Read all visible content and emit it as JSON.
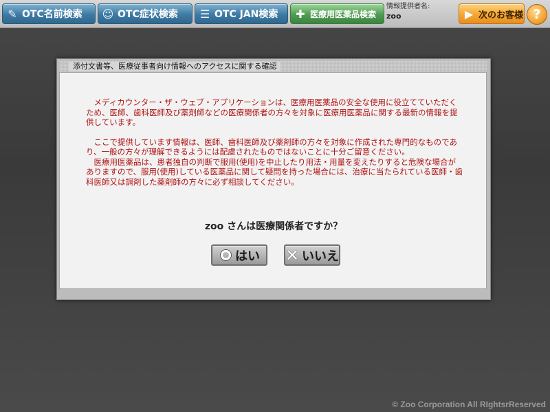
{
  "toolbar": {
    "buttons": [
      {
        "label": "OTC名前検索",
        "icon": "pill-icon"
      },
      {
        "label": "OTC症状検索",
        "icon": "body-icon"
      },
      {
        "label": "OTC JAN検索",
        "icon": "barcode-icon"
      },
      {
        "label": "医療用医薬品検索",
        "icon": "capsule-icon"
      }
    ],
    "info_label": "情報提供者名:",
    "user_name": "zoo",
    "next_label": "次のお客様",
    "help_label": "?"
  },
  "dialog": {
    "title": "添付文書等、医療従事者向け情報へのアクセスに関する確認",
    "paragraphs": [
      "メディカウンター・ザ・ウェブ・アプリケーションは、医療用医薬品の安全な使用に役立てていただくため、医師、歯科医師及び薬剤師などの医療関係者の方々を対象に医療用医薬品に関する最新の情報を提供しています。",
      "ここで提供しています情報は、医師、歯科医師及び薬剤師の方々を対象に作成された専門的なものであり、一般の方々が理解できるようには配慮されたものではないことに十分ご留意ください。",
      "医療用医薬品は、患者独自の判断で服用(使用)を中止したり用法・用量を変えたりすると危険な場合がありますので、服用(使用)している医薬品に関して疑問を持った場合には、治療に当たられている医師・歯科医師又は調剤した薬剤師の方々に必ず相談してください。"
    ],
    "question": "zoo さんは医療関係者ですか？",
    "yes_label": "はい",
    "no_label": "いいえ"
  },
  "footer": "© Zoo Corporation All RIghtsrReserved",
  "colors": {
    "notice_text": "#b01313",
    "toolbar_blue": "#3e7aa3",
    "toolbar_green": "#4f9b52",
    "next_orange": "#f5a534"
  }
}
